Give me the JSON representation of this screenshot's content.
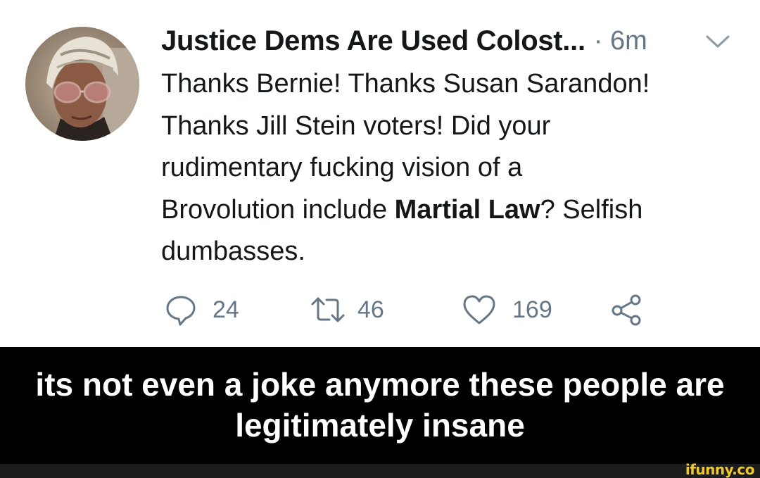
{
  "tweet": {
    "author": "Justice Dems Are Used Colost...",
    "time": "· 6m",
    "lines": [
      "Thanks Bernie! Thanks Susan Sarandon!",
      "Thanks Jill Stein voters! Did your",
      "rudimentary fucking vision of a"
    ],
    "line4_before": "Brovolution include ",
    "line4_bold": "Martial Law",
    "line4_after": "? Selfish",
    "line5": "dumbasses.",
    "actions": {
      "reply_count": "24",
      "retweet_count": "46",
      "like_count": "169"
    },
    "icons": {
      "reply": "speech-bubble-icon",
      "retweet": "retweet-icon",
      "like": "heart-icon",
      "share": "share-icon",
      "menu": "chevron-down-icon"
    },
    "colors": {
      "text": "#14171a",
      "muted": "#657786",
      "caption_bg": "#000000",
      "watermark": "#f0c92b"
    }
  },
  "caption": {
    "line1": "its not even a joke anymore these people are",
    "line2": "legitimately insane"
  },
  "watermark": "ifunny.co"
}
